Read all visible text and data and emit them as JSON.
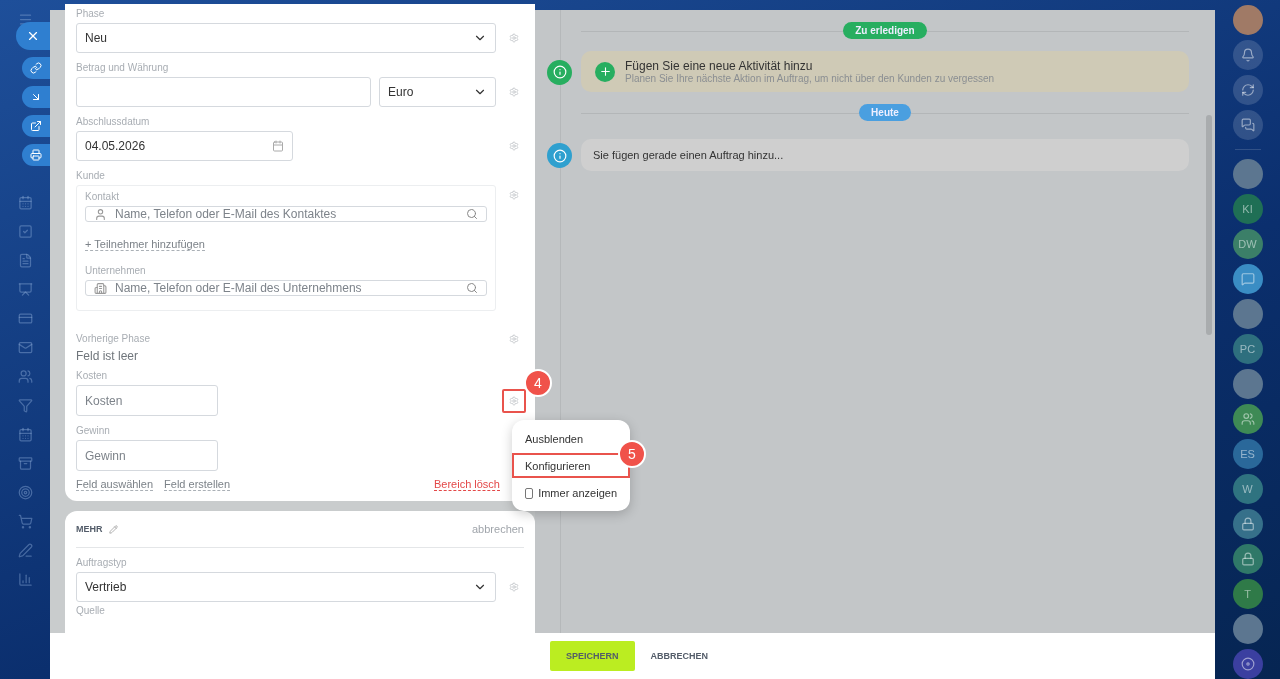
{
  "form": {
    "phase": {
      "label": "Phase",
      "value": "Neu"
    },
    "amount": {
      "label": "Betrag und Währung",
      "currency": "Euro"
    },
    "close_date": {
      "label": "Abschlussdatum",
      "value": "04.05.2026"
    },
    "client": {
      "label": "Kunde",
      "contact_label": "Kontakt",
      "contact_placeholder": "Name, Telefon oder E-Mail des Kontaktes",
      "add_participant": "+ Teilnehmer hinzufügen",
      "company_label": "Unternehmen",
      "company_placeholder": "Name, Telefon oder E-Mail des Unternehmens"
    },
    "previous_phase": {
      "label": "Vorherige Phase",
      "value": "Feld ist leer"
    },
    "cost": {
      "label": "Kosten",
      "placeholder": "Kosten",
      "callout": "4"
    },
    "profit": {
      "label": "Gewinn",
      "placeholder": "Gewinn"
    },
    "links": [
      "Feld auswählen",
      "Feld erstellen"
    ],
    "delete_section": "Bereich lösch"
  },
  "context_menu": [
    {
      "kind": "action",
      "label": "Ausblenden",
      "highlighted": false
    },
    {
      "kind": "action",
      "label": "Konfigurieren",
      "highlighted": true,
      "callout": "5"
    },
    {
      "kind": "checkbox",
      "label": "Immer anzeigen",
      "checked": false
    }
  ],
  "more_section": {
    "title": "MEHR",
    "cancel": "abbrechen",
    "field": {
      "label": "Auftragstyp",
      "value": "Vertrieb"
    },
    "next_label": "Quelle"
  },
  "timeline": [
    {
      "kind": "section",
      "label": "Zu erledigen",
      "color": "#27ae60"
    },
    {
      "kind": "activity",
      "title": "Fügen Sie eine neue Aktivität hinzu",
      "subtitle": "Planen Sie Ihre nächste Aktion im Auftrag, um nicht über den Kunden zu vergessen",
      "color": "#27ae60"
    },
    {
      "kind": "section",
      "label": "Heute",
      "color": "#4a9fe0"
    },
    {
      "kind": "note",
      "text": "Sie fügen gerade einen Auftrag hinzu...",
      "color": "#2fa0cf"
    }
  ],
  "footer": {
    "save": "SPEICHERN",
    "cancel": "ABBRECHEN"
  },
  "chats": [
    {
      "kind": "photo"
    },
    {
      "kind": "initials",
      "text": "KI",
      "color": "#1f6f55"
    },
    {
      "kind": "initials",
      "text": "DW",
      "color": "#3b7f68"
    },
    {
      "kind": "chat",
      "color": "#3a8dc4"
    },
    {
      "kind": "photo"
    },
    {
      "kind": "initials",
      "text": "PC",
      "color": "#2e6f7e"
    },
    {
      "kind": "photo"
    },
    {
      "kind": "group",
      "color": "#3e8a55"
    },
    {
      "kind": "initials",
      "text": "ES",
      "color": "#2a689a"
    },
    {
      "kind": "initials",
      "text": "W",
      "color": "#2f7380"
    },
    {
      "kind": "lock",
      "color": "#36708a"
    },
    {
      "kind": "lock",
      "color": "#2f7868"
    },
    {
      "kind": "initials",
      "text": "T",
      "color": "#2f7a48"
    },
    {
      "kind": "photo"
    }
  ]
}
